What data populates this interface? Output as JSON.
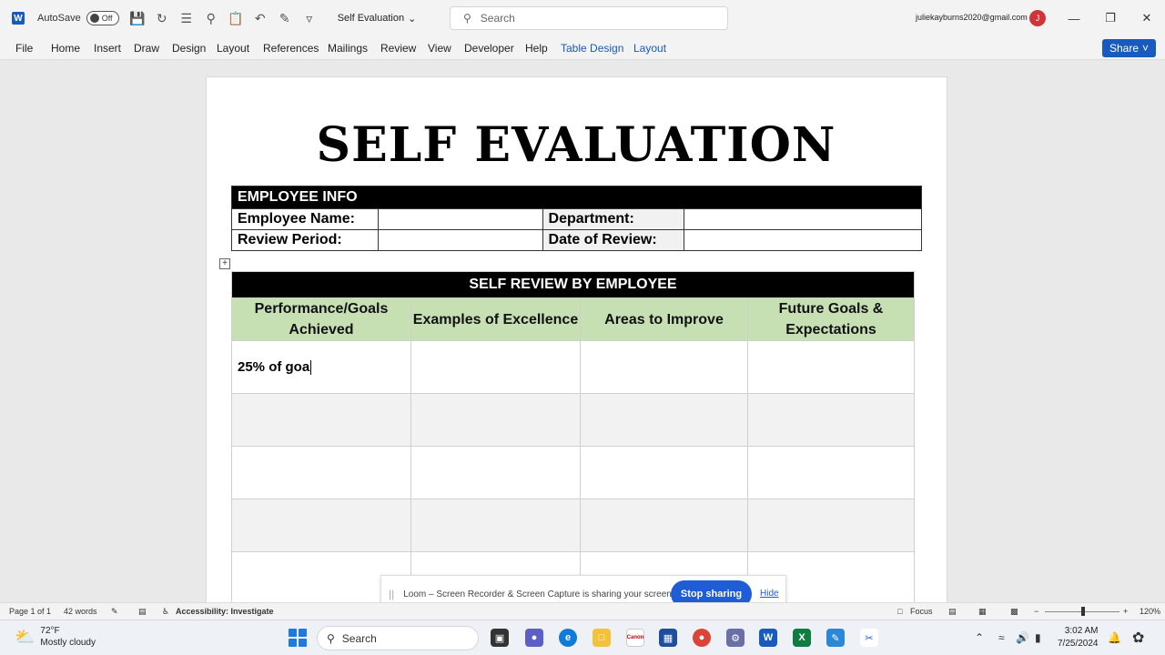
{
  "titlebar": {
    "autosave_label": "AutoSave",
    "autosave_state": "Off",
    "doc_title": "Self Evaluation",
    "search_placeholder": "Search",
    "user_email": "juliekayburns2020@gmail.com",
    "avatar_initial": "J"
  },
  "menu": {
    "items": [
      "File",
      "Home",
      "Insert",
      "Draw",
      "Design",
      "Layout",
      "References",
      "Mailings",
      "Review",
      "View",
      "Developer",
      "Help",
      "Table Design",
      "Layout"
    ],
    "share_label": "Share"
  },
  "document": {
    "heading": "SELF EVALUATION",
    "info_table": {
      "header": "EMPLOYEE INFO",
      "employee_name_label": "Employee Name:",
      "department_label": "Department:",
      "review_period_label": "Review Period:",
      "date_of_review_label": "Date of Review:"
    },
    "review_table": {
      "header": "SELF REVIEW BY EMPLOYEE",
      "columns": [
        "Performance/Goals Achieved",
        "Examples of Excellence",
        "Areas to Improve",
        "Future Goals & Expectations"
      ],
      "first_cell_text": "25% of goa"
    }
  },
  "loom": {
    "message": "Loom – Screen Recorder & Screen Capture is sharing your screen.",
    "stop_label": "Stop sharing",
    "hide_label": "Hide"
  },
  "statusbar": {
    "page": "Page 1 of 1",
    "words": "42 words",
    "accessibility": "Accessibility: Investigate",
    "focus": "Focus",
    "zoom": "120%"
  },
  "taskbar": {
    "weather_temp": "72°F",
    "weather_desc": "Mostly cloudy",
    "search_label": "Search",
    "time": "3:02 AM",
    "date": "7/25/2024"
  },
  "colors": {
    "word_blue": "#185abd",
    "column_header_green": "#c6e0b4",
    "loom_blue": "#1e5dd6"
  }
}
